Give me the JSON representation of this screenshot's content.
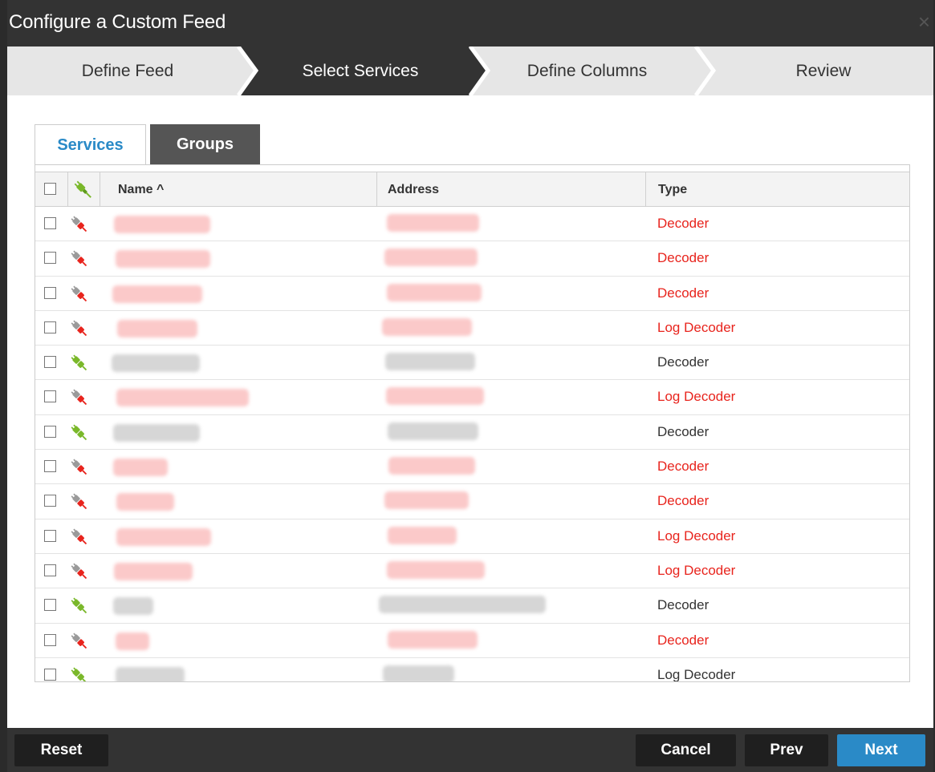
{
  "dialog": {
    "title": "Configure a Custom Feed",
    "close_glyph": "×"
  },
  "wizard": {
    "steps": [
      {
        "label": "Define Feed",
        "state": "done"
      },
      {
        "label": "Select Services",
        "state": "active"
      },
      {
        "label": "Define Columns",
        "state": "pending"
      },
      {
        "label": "Review",
        "state": "pending"
      }
    ]
  },
  "tabs": {
    "services": "Services",
    "groups": "Groups",
    "active": "Services"
  },
  "table": {
    "columns": {
      "name": "Name ^",
      "address": "Address",
      "type": "Type"
    },
    "sort": {
      "column": "Name",
      "direction": "ascending"
    },
    "rows": [
      {
        "type": "Decoder",
        "status": "offline"
      },
      {
        "type": "Decoder",
        "status": "offline"
      },
      {
        "type": "Decoder",
        "status": "offline"
      },
      {
        "type": "Log Decoder",
        "status": "offline"
      },
      {
        "type": "Decoder",
        "status": "online"
      },
      {
        "type": "Log Decoder",
        "status": "offline"
      },
      {
        "type": "Decoder",
        "status": "online"
      },
      {
        "type": "Decoder",
        "status": "offline"
      },
      {
        "type": "Decoder",
        "status": "offline"
      },
      {
        "type": "Log Decoder",
        "status": "offline"
      },
      {
        "type": "Log Decoder",
        "status": "offline"
      },
      {
        "type": "Decoder",
        "status": "online"
      },
      {
        "type": "Decoder",
        "status": "offline"
      },
      {
        "type": "Log Decoder",
        "status": "online"
      }
    ]
  },
  "footer": {
    "reset": "Reset",
    "cancel": "Cancel",
    "prev": "Prev",
    "next": "Next"
  },
  "colors": {
    "offline": "#e8241d",
    "online": "#333333",
    "accent": "#2a8ac7",
    "plug_online": "#7ab82a",
    "plug_offline": "#e8241d"
  },
  "icons": {
    "online_plug": "connected-plug-icon",
    "offline_plug": "disconnected-plug-icon"
  }
}
